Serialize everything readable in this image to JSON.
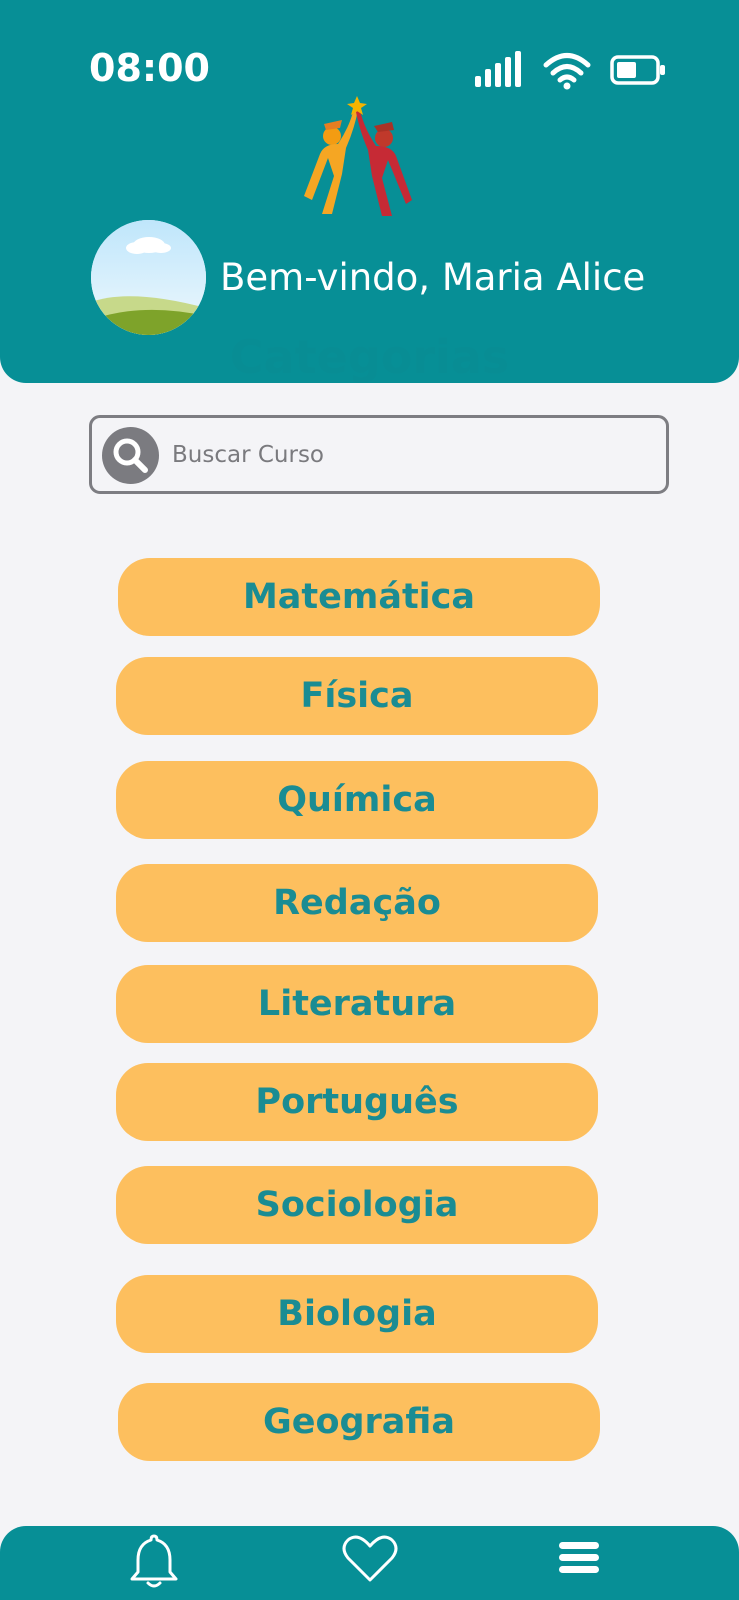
{
  "status_bar": {
    "time": "08:00"
  },
  "header": {
    "greeting": "Bem-vindo, Maria Alice",
    "section_title": "Categorias"
  },
  "search": {
    "placeholder": "Buscar Curso",
    "value": ""
  },
  "categories": [
    "Matemática",
    "Física",
    "Química",
    "Redação",
    "Literatura",
    "Português",
    "Sociologia",
    "Biologia",
    "Geografia"
  ],
  "bottom_nav": {
    "items": [
      "bell-icon",
      "heart-icon",
      "menu-icon"
    ]
  },
  "colors": {
    "primary": "#078f96",
    "button": "#fdbf5e",
    "button_text": "#1a8c93",
    "background": "#f4f4f7"
  }
}
